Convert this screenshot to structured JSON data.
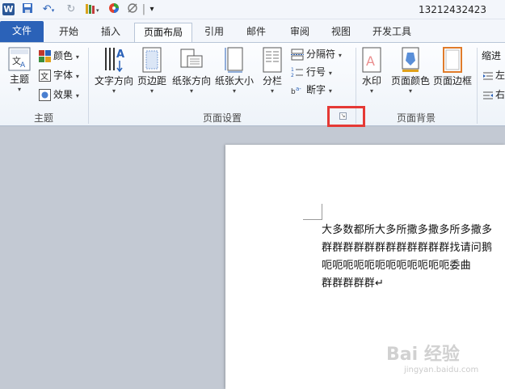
{
  "app": {
    "logo": "W",
    "window_title": "13212432423"
  },
  "qat": {
    "separator": "|",
    "customize": "▾"
  },
  "tabs": [
    "文件",
    "开始",
    "插入",
    "页面布局",
    "引用",
    "邮件",
    "审阅",
    "视图",
    "开发工具"
  ],
  "ribbon": {
    "themes": {
      "themes_label": "主题",
      "colors_label": "颜色",
      "fonts_label": "字体",
      "effects_label": "效果",
      "group_label": "主题"
    },
    "page_setup": {
      "text_direction": "文字方向",
      "margins": "页边距",
      "orientation": "纸张方向",
      "size": "纸张大小",
      "columns": "分栏",
      "breaks": "分隔符",
      "line_numbers": "行号",
      "hyphenation": "断字",
      "group_label": "页面设置"
    },
    "page_background": {
      "watermark": "水印",
      "page_color": "页面颜色",
      "page_borders": "页面边框",
      "group_label": "页面背景"
    },
    "paragraph": {
      "indent_label": "缩进",
      "left_partial": "左",
      "right_partial": "右"
    }
  },
  "document": {
    "lines": [
      "大多数都所大多所撒多撒多所多撒多",
      "群群群群群群群群群群群群找请问鹅",
      "呃呃呃呃呃呃呃呃呃呃呃呃委曲",
      "群群群群群↵"
    ]
  },
  "watermark": {
    "text": "Bai 经验",
    "sub": "jingyan.baidu.com"
  },
  "colors": {
    "file_tab": "#2b62b8",
    "highlight": "#e53935",
    "ribbon_bg": "#f3f6fb"
  }
}
